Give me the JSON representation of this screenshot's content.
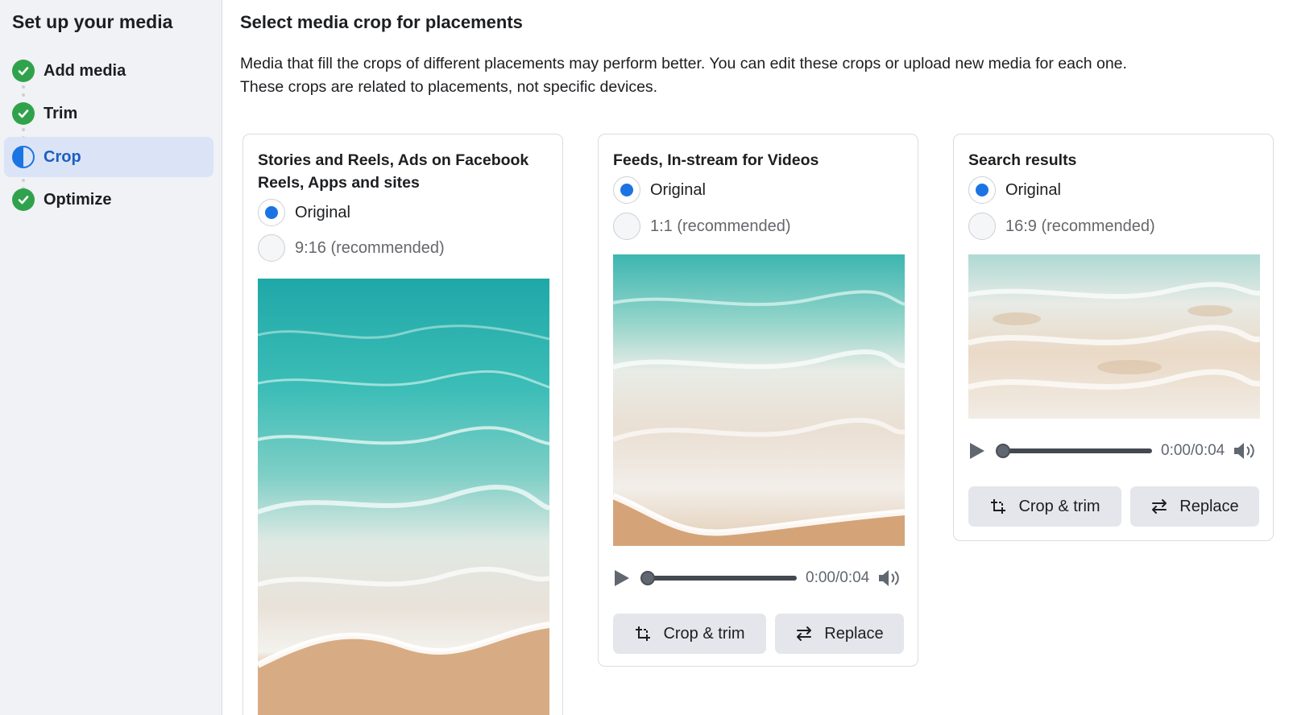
{
  "sidebar": {
    "title": "Set up your media",
    "steps": [
      {
        "label": "Add media",
        "state": "done",
        "icon": "check-circle-icon"
      },
      {
        "label": "Trim",
        "state": "done",
        "icon": "check-circle-icon"
      },
      {
        "label": "Crop",
        "state": "current",
        "icon": "half-circle-icon"
      },
      {
        "label": "Optimize",
        "state": "done",
        "icon": "check-circle-icon"
      }
    ]
  },
  "main": {
    "title": "Select media crop for placements",
    "description_line1": "Media that fill the crops of different placements may perform better. You can edit these crops or upload new media for each one.",
    "description_line2": "These crops are related to placements, not specific devices."
  },
  "cards": [
    {
      "title": "Stories and Reels, Ads on Facebook Reels, Apps and sites",
      "options": [
        {
          "label": "Original",
          "checked": true
        },
        {
          "label": "9:16 (recommended)",
          "checked": false
        }
      ]
    },
    {
      "title": "Feeds, In-stream for Videos",
      "options": [
        {
          "label": "Original",
          "checked": true
        },
        {
          "label": "1:1 (recommended)",
          "checked": false
        }
      ],
      "time": "0:00/0:04",
      "progress": 0,
      "crop_label": "Crop & trim",
      "replace_label": "Replace"
    },
    {
      "title": "Search results",
      "options": [
        {
          "label": "Original",
          "checked": true
        },
        {
          "label": "16:9 (recommended)",
          "checked": false
        }
      ],
      "time": "0:00/0:04",
      "progress": 0,
      "crop_label": "Crop & trim",
      "replace_label": "Replace"
    }
  ],
  "colors": {
    "accent": "#1b74e4",
    "done": "#31a24c",
    "sidebar_bg": "#f0f2f5",
    "active_step_bg": "#dbe4f6",
    "button_bg": "#e4e6eb"
  },
  "icons": [
    "play-icon",
    "volume-icon",
    "crop-icon",
    "swap-arrows-icon"
  ]
}
